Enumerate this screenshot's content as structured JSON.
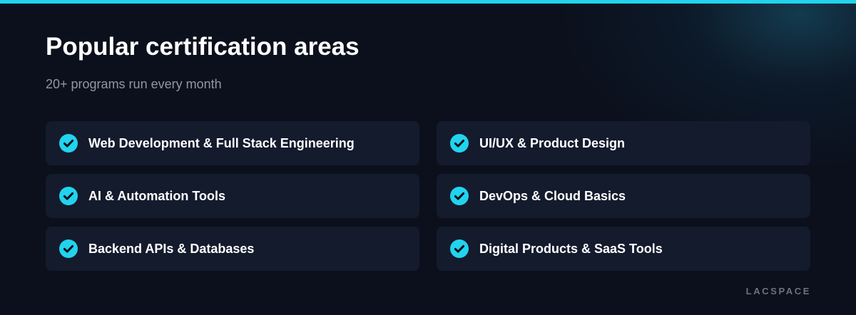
{
  "header": {
    "title": "Popular certification areas",
    "subtitle": "20+ programs run every month"
  },
  "areas": [
    {
      "label": "Web Development & Full Stack Engineering",
      "icon": "check-circle-icon"
    },
    {
      "label": "UI/UX & Product Design",
      "icon": "check-circle-icon"
    },
    {
      "label": "AI & Automation Tools",
      "icon": "check-circle-icon"
    },
    {
      "label": "DevOps & Cloud Basics",
      "icon": "check-circle-icon"
    },
    {
      "label": "Backend APIs & Databases",
      "icon": "check-circle-icon"
    },
    {
      "label": "Digital Products & SaaS Tools",
      "icon": "check-circle-icon"
    }
  ],
  "footer": {
    "brand": "LACSPACE"
  },
  "colors": {
    "accent": "#22d3ee",
    "background": "#0b101c",
    "card": "#141b2d",
    "muted_text": "#8f97a6",
    "brand_text": "#6b7280"
  }
}
